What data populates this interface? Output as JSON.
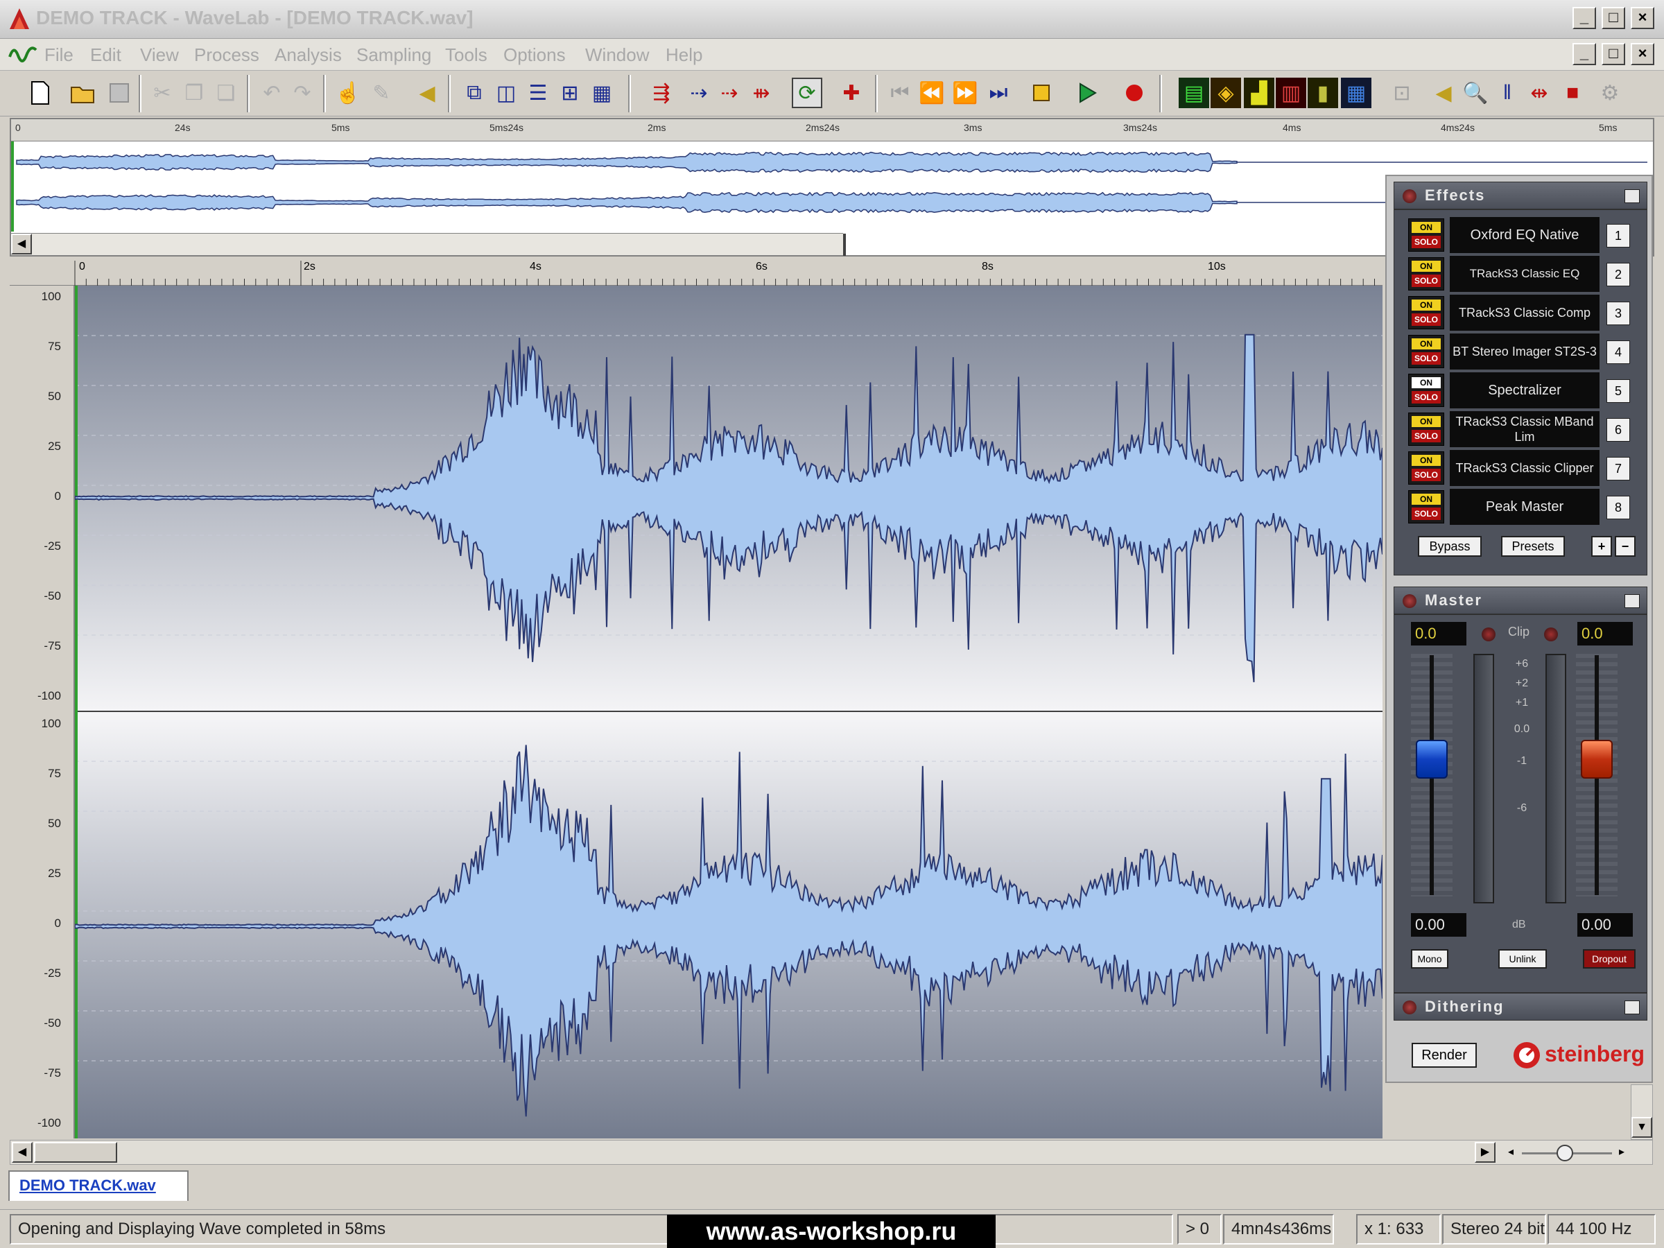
{
  "window": {
    "title": "DEMO TRACK - WaveLab - [DEMO TRACK.wav]",
    "buttons": [
      "_",
      "□",
      "×"
    ]
  },
  "menu": [
    "File",
    "Edit",
    "View",
    "Process",
    "Analysis",
    "Sampling",
    "Tools",
    "Options",
    "Window",
    "Help"
  ],
  "overview_ruler": [
    "0",
    "24s",
    "5ms",
    "5ms24s",
    "2ms",
    "2ms24s",
    "3ms",
    "3ms24s",
    "4ms",
    "4ms24s",
    "5ms"
  ],
  "main_ruler": [
    "0",
    "2s",
    "4s",
    "6s",
    "8s",
    "10s"
  ],
  "y_axis": {
    "top": [
      "100",
      "75",
      "50",
      "25",
      "0",
      "-25",
      "-50",
      "-75",
      "-100"
    ],
    "bottom": [
      "100",
      "75",
      "50",
      "25",
      "0",
      "-25",
      "-50",
      "-75",
      "-100"
    ]
  },
  "effects": {
    "title": "Effects",
    "on_label": "ON",
    "solo_label": "SOLO",
    "slots": [
      {
        "num": "1",
        "name": "Oxford EQ Native",
        "on": true
      },
      {
        "num": "2",
        "name": "TRackS3 Classic EQ",
        "on": true
      },
      {
        "num": "3",
        "name": "TRackS3 Classic Comp",
        "on": true
      },
      {
        "num": "4",
        "name": "BT Stereo Imager ST2S-3",
        "on": true
      },
      {
        "num": "5",
        "name": "Spectralizer",
        "on": false
      },
      {
        "num": "6",
        "name": "TRackS3 Classic MBand Lim",
        "on": true
      },
      {
        "num": "7",
        "name": "TRackS3 Classic Clipper",
        "on": true
      },
      {
        "num": "8",
        "name": "Peak Master",
        "on": true
      }
    ],
    "bypass": "Bypass",
    "presets": "Presets",
    "plus": "+",
    "minus": "−"
  },
  "master": {
    "title": "Master",
    "left_peak": "0.0",
    "right_peak": "0.0",
    "clip": "Clip",
    "scale": [
      "+6",
      "+2",
      "+1",
      "0.0",
      "-1",
      "-6"
    ],
    "left_gain": "0.00",
    "right_gain": "0.00",
    "db": "dB",
    "mono": "Mono",
    "unlink": "Unlink",
    "dropout": "Dropout"
  },
  "dithering": {
    "title": "Dithering",
    "render": "Render",
    "brand": "steinberg"
  },
  "tab": "DEMO TRACK.wav",
  "status": {
    "message": "Opening and Displaying Wave completed in 58ms",
    "cursor": "> 0",
    "length": "4mn4s436ms",
    "zoom": "x 1: 633",
    "format": "Stereo 24 bit",
    "rate": "44 100 Hz"
  },
  "watermark": "www.as-workshop.ru",
  "colors": {
    "wave_fill": "#a8c8f0",
    "wave_edge": "#2a3870",
    "accent_yellow": "#f0d020",
    "solo_red": "#b01010"
  }
}
